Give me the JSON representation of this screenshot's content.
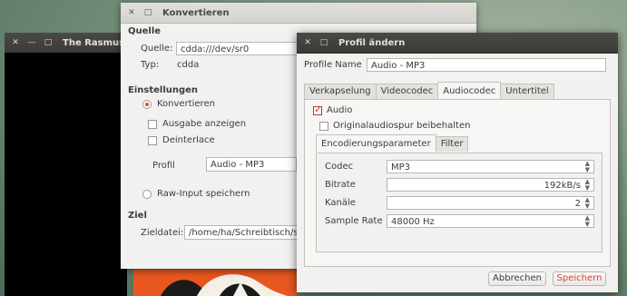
{
  "player": {
    "title": "The Rasmus"
  },
  "convert": {
    "title": "Konvertieren",
    "source_heading": "Quelle",
    "source_label": "Quelle:",
    "source_value": "cdda:///dev/sr0",
    "type_label": "Typ:",
    "type_value": "cdda",
    "settings_heading": "Einstellungen",
    "convert_radio": "Konvertieren",
    "show_output": "Ausgabe anzeigen",
    "deinterlace": "Deinterlace",
    "profile_label": "Profil",
    "profile_value": "Audio - MP3",
    "raw_input": "Raw-Input speichern",
    "target_heading": "Ziel",
    "target_label": "Zieldatei:",
    "target_value": "/home/ha/Schreibtisch/s"
  },
  "profil": {
    "title": "Profil ändern",
    "name_label": "Profile Name",
    "name_value": "Audio - MP3",
    "tabs": [
      "Verkapselung",
      "Videocodec",
      "Audiocodec",
      "Untertitel"
    ],
    "audio_check": "Audio",
    "keep_original": "Originalaudiospur beibehalten",
    "subtabs": [
      "Encodierungsparameter",
      "Filter"
    ],
    "codec_label": "Codec",
    "codec_value": "MP3",
    "bitrate_label": "Bitrate",
    "bitrate_value": "192kB/s",
    "channels_label": "Kanäle",
    "channels_value": "2",
    "samplerate_label": "Sample Rate",
    "samplerate_value": "48000 Hz",
    "cancel": "Abbrechen",
    "save": "Speichern"
  }
}
